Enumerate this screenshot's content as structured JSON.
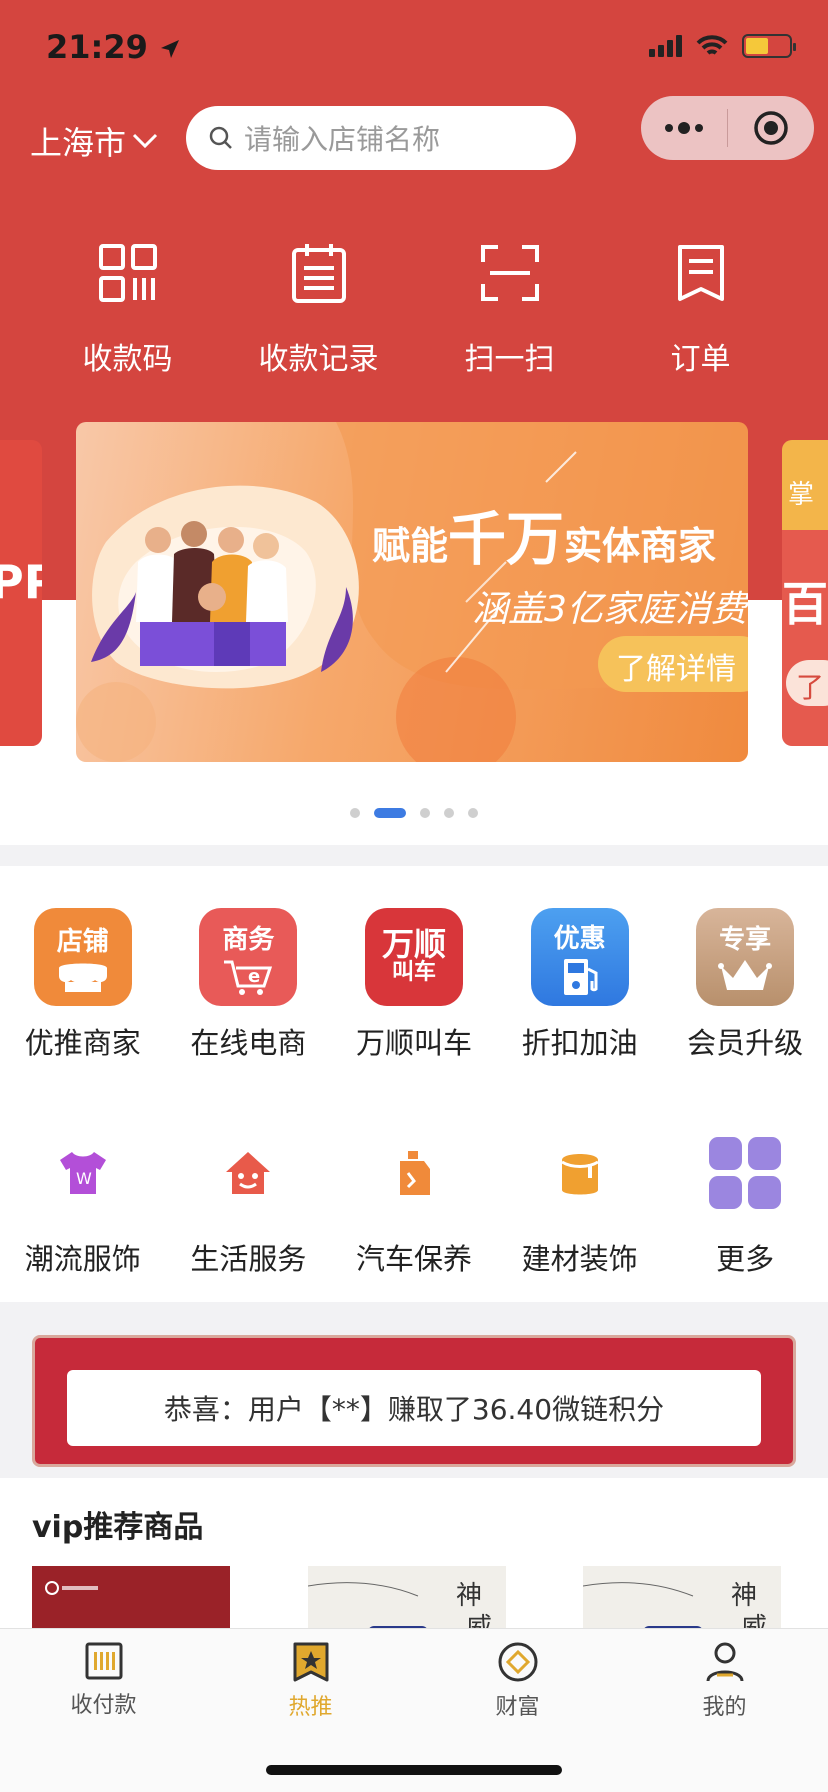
{
  "status_bar": {
    "time": "21:29"
  },
  "header": {
    "city": "上海市",
    "search_placeholder": "请输入店铺名称"
  },
  "quick_actions": [
    {
      "label": "收款码",
      "icon": "qr-code-icon"
    },
    {
      "label": "收款记录",
      "icon": "calendar-icon"
    },
    {
      "label": "扫一扫",
      "icon": "scan-icon"
    },
    {
      "label": "订单",
      "icon": "order-icon"
    }
  ],
  "banner": {
    "title_pre": "赋能",
    "title_big": "千万",
    "title_post": "实体商家",
    "subtitle": "涵盖3亿家庭消费",
    "button": "了解详情",
    "left_peek_text": "PP",
    "right_peek_tag": "掌",
    "right_peek_text": "百",
    "right_peek_button": "了",
    "page_count": 5,
    "active_page": 1
  },
  "categories_row1": [
    {
      "label": "优推商家",
      "badge": "店铺",
      "color": "#f08a3a"
    },
    {
      "label": "在线电商",
      "badge": "商务",
      "color": "#e85a58"
    },
    {
      "label": "万顺叫车",
      "badge": "万顺",
      "badge2": "叫车",
      "color": "#d8363a"
    },
    {
      "label": "折扣加油",
      "badge": "优惠",
      "color": "#3d8ae8"
    },
    {
      "label": "会员升级",
      "badge": "专享",
      "color": "#c9a07a"
    }
  ],
  "categories_row2": [
    {
      "label": "潮流服饰",
      "icon": "tshirt-icon",
      "color": "#b34fd8"
    },
    {
      "label": "生活服务",
      "icon": "house-icon",
      "color": "#e85a4a"
    },
    {
      "label": "汽车保养",
      "icon": "oil-can-icon",
      "color": "#f08a3a"
    },
    {
      "label": "建材装饰",
      "icon": "paint-bucket-icon",
      "color": "#f0a030"
    },
    {
      "label": "更多",
      "icon": "grid-icon",
      "color": "#9b86e0"
    }
  ],
  "notice": {
    "text": "恭喜：用户【**】赚取了36.40微链积分"
  },
  "vip": {
    "title": "vip推荐商品"
  },
  "tabbar": [
    {
      "label": "收付款",
      "icon": "barcode-icon",
      "active": false
    },
    {
      "label": "热推",
      "icon": "star-bookmark-icon",
      "active": true
    },
    {
      "label": "财富",
      "icon": "coin-icon",
      "active": false
    },
    {
      "label": "我的",
      "icon": "person-icon",
      "active": false
    }
  ]
}
